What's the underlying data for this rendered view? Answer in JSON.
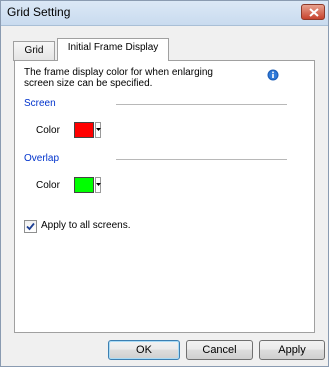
{
  "window": {
    "title": "Grid Setting"
  },
  "tabs": [
    {
      "label": "Grid"
    },
    {
      "label": "Initial Frame Display",
      "active": true
    }
  ],
  "panel": {
    "description": "The frame display color for when enlarging screen size can be specified.",
    "info_icon": "info-icon",
    "screen": {
      "section_label": "Screen",
      "color_label": "Color",
      "color_value": "#ff0000"
    },
    "overlap": {
      "section_label": "Overlap",
      "color_label": "Color",
      "color_value": "#00ff00"
    },
    "apply_all": {
      "label": "Apply to all screens.",
      "checked": true
    }
  },
  "buttons": {
    "ok": "OK",
    "cancel": "Cancel",
    "apply": "Apply"
  }
}
